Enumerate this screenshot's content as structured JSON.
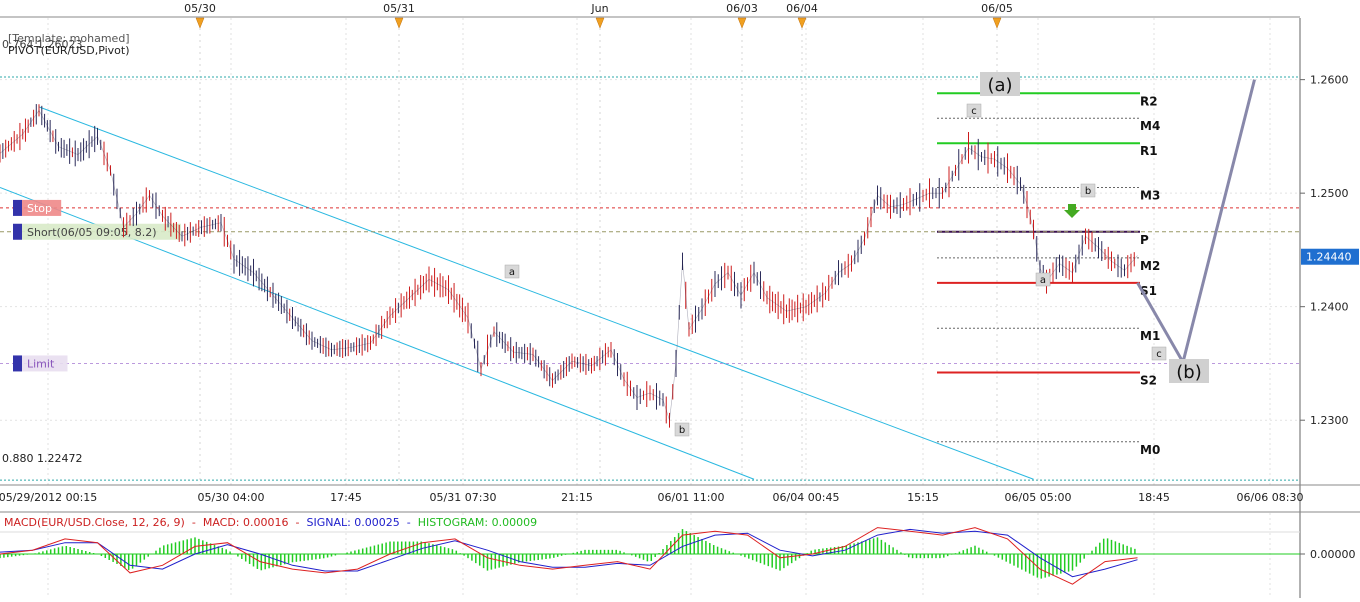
{
  "chart_data": [
    {
      "type": "candlestick",
      "symbol": "EUR/USD",
      "template_label": "[Template: mohamed]",
      "indicator_label": "PIVOT(EUR/USD,Pivot)",
      "fib_top_label": "0.764 1.26023",
      "fib_bottom_label": "0.880 1.22472",
      "ylim": [
        1.2246,
        1.2638
      ],
      "y_ticks": [
        "1.2600",
        "1.2500",
        "1.2400",
        "1.2300"
      ],
      "y_tick_values": [
        1.26,
        1.25,
        1.24,
        1.23
      ],
      "current_price": "1.24440",
      "current_price_value": 1.2444,
      "x_labels": [
        "05/29/2012 00:15",
        "05/30 04:00",
        "17:45",
        "05/31 07:30",
        "21:15",
        "06/01 11:00",
        "06/04 00:45",
        "15:15",
        "06/05 05:00",
        "18:45",
        "06/06 08:30"
      ],
      "top_markers": [
        "05/30",
        "05/31",
        "Jun",
        "06/03",
        "06/04",
        "06/05"
      ],
      "pivot_levels": [
        {
          "name": "R2",
          "value": 1.2588,
          "color": "#22cc22"
        },
        {
          "name": "M4",
          "value": 1.2566,
          "color": "#666666"
        },
        {
          "name": "R1",
          "value": 1.2544,
          "color": "#22cc22"
        },
        {
          "name": "M3",
          "value": 1.2505,
          "color": "#666666"
        },
        {
          "name": "P",
          "value": 1.2466,
          "color": "#3a1050"
        },
        {
          "name": "M2",
          "value": 1.2443,
          "color": "#666666"
        },
        {
          "name": "S1",
          "value": 1.2421,
          "color": "#dd2222"
        },
        {
          "name": "M1",
          "value": 1.2381,
          "color": "#666666"
        },
        {
          "name": "S2",
          "value": 1.2342,
          "color": "#dd2222"
        },
        {
          "name": "M0",
          "value": 1.2281,
          "color": "#666666"
        }
      ],
      "orders": [
        {
          "label": "Stop",
          "value": 1.2487
        },
        {
          "label": "Short(06/05 09:05, 8.2)",
          "value": 1.2466
        },
        {
          "label": "Limit",
          "value": 1.235
        }
      ],
      "wave_labels": [
        "(a)",
        "(b)",
        "a",
        "b",
        "c",
        "a",
        "b",
        "c"
      ],
      "price_path": [
        [
          0,
          1.2535
        ],
        [
          7,
          1.2552
        ],
        [
          12,
          1.2573
        ],
        [
          18,
          1.2541
        ],
        [
          24,
          1.2534
        ],
        [
          30,
          1.255
        ],
        [
          34,
          1.252
        ],
        [
          38,
          1.247
        ],
        [
          42,
          1.2482
        ],
        [
          46,
          1.2498
        ],
        [
          50,
          1.248
        ],
        [
          56,
          1.2462
        ],
        [
          62,
          1.247
        ],
        [
          68,
          1.2474
        ],
        [
          72,
          1.2442
        ],
        [
          78,
          1.243
        ],
        [
          84,
          1.241
        ],
        [
          90,
          1.239
        ],
        [
          96,
          1.237
        ],
        [
          102,
          1.2362
        ],
        [
          108,
          1.2364
        ],
        [
          114,
          1.2368
        ],
        [
          120,
          1.2392
        ],
        [
          126,
          1.2408
        ],
        [
          132,
          1.2424
        ],
        [
          138,
          1.2415
        ],
        [
          144,
          1.239
        ],
        [
          148,
          1.2345
        ],
        [
          152,
          1.2378
        ],
        [
          158,
          1.236
        ],
        [
          164,
          1.2358
        ],
        [
          170,
          1.2335
        ],
        [
          176,
          1.2352
        ],
        [
          182,
          1.2348
        ],
        [
          188,
          1.2362
        ],
        [
          192,
          1.2336
        ],
        [
          196,
          1.232
        ],
        [
          200,
          1.2324
        ],
        [
          204,
          1.2318
        ],
        [
          206,
          1.23
        ],
        [
          208,
          1.235
        ],
        [
          210,
          1.244
        ],
        [
          212,
          1.238
        ],
        [
          216,
          1.2398
        ],
        [
          220,
          1.242
        ],
        [
          224,
          1.243
        ],
        [
          228,
          1.241
        ],
        [
          232,
          1.243
        ],
        [
          236,
          1.2408
        ],
        [
          242,
          1.2396
        ],
        [
          248,
          1.24
        ],
        [
          254,
          1.2412
        ],
        [
          258,
          1.243
        ],
        [
          262,
          1.2438
        ],
        [
          266,
          1.246
        ],
        [
          270,
          1.2498
        ],
        [
          274,
          1.2488
        ],
        [
          278,
          1.249
        ],
        [
          282,
          1.2495
        ],
        [
          286,
          1.25
        ],
        [
          290,
          1.25
        ],
        [
          294,
          1.252
        ],
        [
          298,
          1.254
        ],
        [
          302,
          1.2532
        ],
        [
          306,
          1.253
        ],
        [
          310,
          1.2522
        ],
        [
          314,
          1.2508
        ],
        [
          316,
          1.249
        ],
        [
          318,
          1.2468
        ],
        [
          320,
          1.2434
        ],
        [
          322,
          1.2422
        ],
        [
          326,
          1.2438
        ],
        [
          330,
          1.243
        ],
        [
          334,
          1.2462
        ],
        [
          338,
          1.2452
        ],
        [
          342,
          1.244
        ],
        [
          346,
          1.2432
        ],
        [
          350,
          1.2445
        ]
      ],
      "projection_path": [
        [
          350,
          1.2421
        ],
        [
          364,
          1.2351
        ],
        [
          386,
          1.26
        ]
      ],
      "channel_lines": [
        {
          "from": [
            12,
            1.2576
          ],
          "to": [
            318,
            1.2248
          ]
        },
        {
          "from": [
            0,
            1.2505
          ],
          "to": [
            232,
            1.2248
          ]
        }
      ],
      "fib_lines": [
        1.26023,
        1.22472
      ],
      "x_range": [
        0,
        400
      ]
    },
    {
      "type": "line",
      "title": "MACD(EUR/USD.Close, 12, 26, 9)",
      "macd_label": "MACD: 0.00016",
      "signal_label": "SIGNAL: 0.00025",
      "histogram_label": "HISTOGRAM: 0.00009",
      "y_tick": "0.00000",
      "series": [
        {
          "name": "MACD",
          "color": "#dd2020"
        },
        {
          "name": "SIGNAL",
          "color": "#2020cc"
        },
        {
          "name": "HISTOGRAM",
          "color": "#22cc22"
        }
      ],
      "macd_values": [
        [
          0,
          0.0
        ],
        [
          10,
          0.0002
        ],
        [
          20,
          0.0008
        ],
        [
          30,
          0.0006
        ],
        [
          40,
          -0.001
        ],
        [
          50,
          -0.0006
        ],
        [
          60,
          0.0004
        ],
        [
          70,
          0.0006
        ],
        [
          80,
          -0.0004
        ],
        [
          90,
          -0.0008
        ],
        [
          100,
          -0.001
        ],
        [
          110,
          -0.0008
        ],
        [
          120,
          0.0
        ],
        [
          130,
          0.0006
        ],
        [
          140,
          0.0008
        ],
        [
          150,
          -0.0002
        ],
        [
          160,
          -0.0006
        ],
        [
          170,
          -0.0008
        ],
        [
          180,
          -0.0006
        ],
        [
          190,
          -0.0004
        ],
        [
          200,
          -0.0008
        ],
        [
          210,
          0.001
        ],
        [
          220,
          0.0012
        ],
        [
          230,
          0.001
        ],
        [
          240,
          -0.0002
        ],
        [
          250,
          0.0
        ],
        [
          260,
          0.0004
        ],
        [
          270,
          0.0014
        ],
        [
          280,
          0.0012
        ],
        [
          290,
          0.001
        ],
        [
          300,
          0.0014
        ],
        [
          310,
          0.0008
        ],
        [
          320,
          -0.0008
        ],
        [
          330,
          -0.0016
        ],
        [
          340,
          -0.0004
        ],
        [
          350,
          -0.0002
        ]
      ],
      "signal_values": [
        [
          0,
          0.0001
        ],
        [
          10,
          0.0002
        ],
        [
          20,
          0.0006
        ],
        [
          30,
          0.0006
        ],
        [
          40,
          -0.0006
        ],
        [
          50,
          -0.0008
        ],
        [
          60,
          0.0
        ],
        [
          70,
          0.0005
        ],
        [
          80,
          0.0
        ],
        [
          90,
          -0.0006
        ],
        [
          100,
          -0.0009
        ],
        [
          110,
          -0.0009
        ],
        [
          120,
          -0.0003
        ],
        [
          130,
          0.0003
        ],
        [
          140,
          0.0007
        ],
        [
          150,
          0.0002
        ],
        [
          160,
          -0.0004
        ],
        [
          170,
          -0.0007
        ],
        [
          180,
          -0.0007
        ],
        [
          190,
          -0.0005
        ],
        [
          200,
          -0.0006
        ],
        [
          210,
          0.0004
        ],
        [
          220,
          0.001
        ],
        [
          230,
          0.0011
        ],
        [
          240,
          0.0002
        ],
        [
          250,
          -0.0001
        ],
        [
          260,
          0.0002
        ],
        [
          270,
          0.001
        ],
        [
          280,
          0.0013
        ],
        [
          290,
          0.0011
        ],
        [
          300,
          0.0012
        ],
        [
          310,
          0.001
        ],
        [
          320,
          -0.0002
        ],
        [
          330,
          -0.0012
        ],
        [
          340,
          -0.0008
        ],
        [
          350,
          -0.0003
        ]
      ],
      "ylim": [
        -0.0018,
        0.0018
      ]
    }
  ]
}
